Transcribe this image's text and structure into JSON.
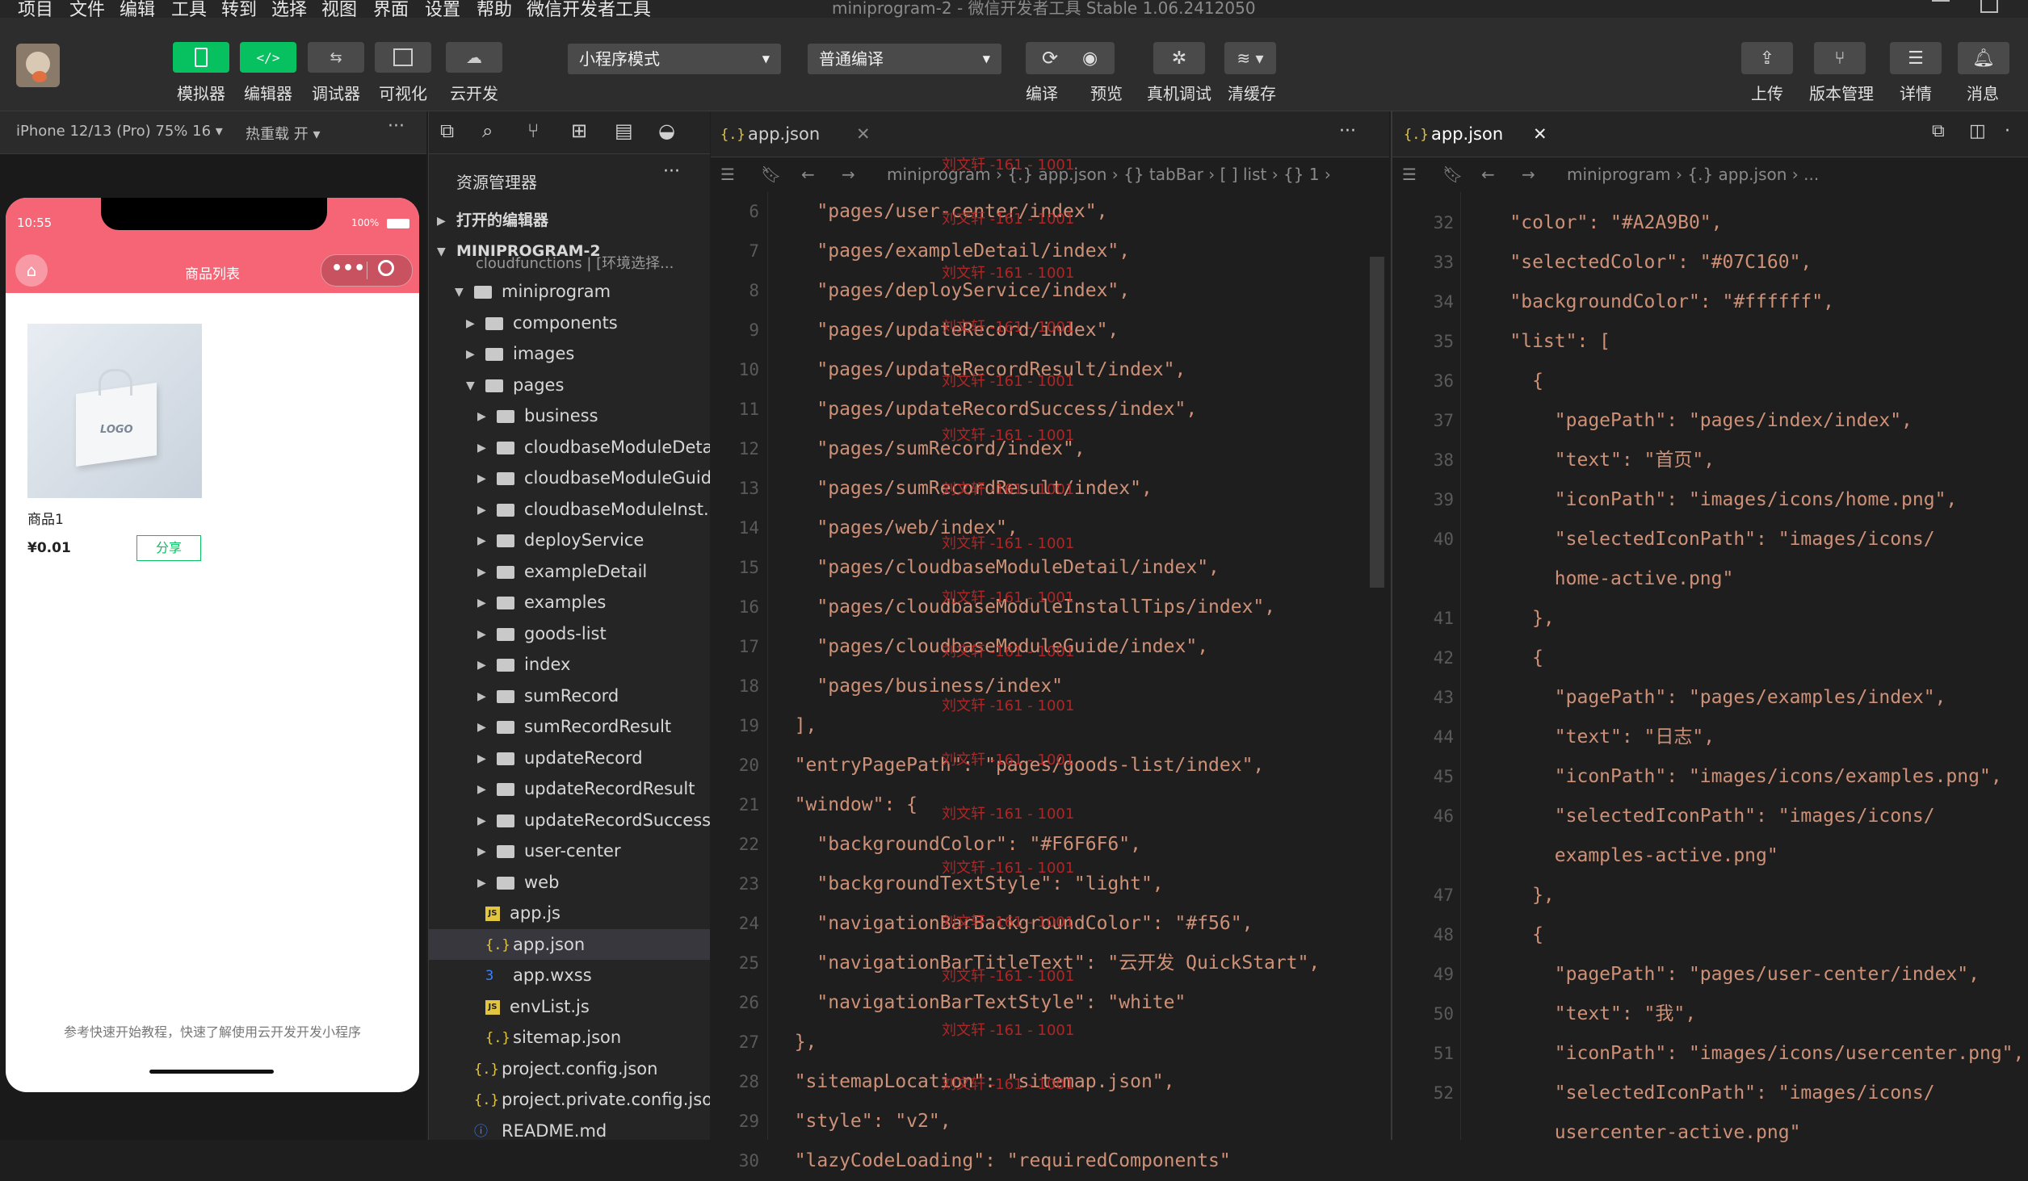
{
  "menu": [
    "项目",
    "文件",
    "编辑",
    "工具",
    "转到",
    "选择",
    "视图",
    "界面",
    "设置",
    "帮助",
    "微信开发者工具"
  ],
  "window_title": "miniprogram-2 - 微信开发者工具 Stable 1.06.2412050",
  "toolbar": {
    "simulator": "模拟器",
    "editor": "编辑器",
    "debugger": "调试器",
    "visual": "可视化",
    "cloud": "云开发",
    "mode": "小程序模式",
    "compile_mode": "普通编译",
    "compile": "编译",
    "preview": "预览",
    "real_debug": "真机调试",
    "clear_cache": "清缓存",
    "upload": "上传",
    "version": "版本管理",
    "details": "详情",
    "messages": "消息"
  },
  "simulator": {
    "device": "iPhone 12/13 (Pro) 75% 16 ▾",
    "hot_reload": "热重载 开 ▾",
    "time": "10:55",
    "battery": "100%",
    "nav_title": "商品列表",
    "product_name": "商品1",
    "product_price": "¥0.01",
    "share": "分享",
    "image_logo": "LOGO",
    "footer_text": "参考快速开始教程，快速了解使用云开发开发小程序"
  },
  "explorer": {
    "title": "资源管理器",
    "open_editors": "打开的编辑器",
    "project": "MINIPROGRAM-2",
    "partial_row": "cloudfunctions | [环境选择...",
    "items": [
      {
        "label": "miniprogram",
        "depth": 1,
        "kind": "folder",
        "open": true
      },
      {
        "label": "components",
        "depth": 2,
        "kind": "folder"
      },
      {
        "label": "images",
        "depth": 2,
        "kind": "folder"
      },
      {
        "label": "pages",
        "depth": 2,
        "kind": "folder",
        "open": true
      },
      {
        "label": "business",
        "depth": 3,
        "kind": "folder"
      },
      {
        "label": "cloudbaseModuleDetail",
        "depth": 3,
        "kind": "folder"
      },
      {
        "label": "cloudbaseModuleGuide",
        "depth": 3,
        "kind": "folder"
      },
      {
        "label": "cloudbaseModuleInst...",
        "depth": 3,
        "kind": "folder"
      },
      {
        "label": "deployService",
        "depth": 3,
        "kind": "folder"
      },
      {
        "label": "exampleDetail",
        "depth": 3,
        "kind": "folder"
      },
      {
        "label": "examples",
        "depth": 3,
        "kind": "folder"
      },
      {
        "label": "goods-list",
        "depth": 3,
        "kind": "folder"
      },
      {
        "label": "index",
        "depth": 3,
        "kind": "folder"
      },
      {
        "label": "sumRecord",
        "depth": 3,
        "kind": "folder"
      },
      {
        "label": "sumRecordResult",
        "depth": 3,
        "kind": "folder"
      },
      {
        "label": "updateRecord",
        "depth": 3,
        "kind": "folder"
      },
      {
        "label": "updateRecordResult",
        "depth": 3,
        "kind": "folder"
      },
      {
        "label": "updateRecordSuccess",
        "depth": 3,
        "kind": "folder"
      },
      {
        "label": "user-center",
        "depth": 3,
        "kind": "folder"
      },
      {
        "label": "web",
        "depth": 3,
        "kind": "folder"
      },
      {
        "label": "app.js",
        "depth": 2,
        "kind": "js"
      },
      {
        "label": "app.json",
        "depth": 2,
        "kind": "json",
        "selected": true
      },
      {
        "label": "app.wxss",
        "depth": 2,
        "kind": "css"
      },
      {
        "label": "envList.js",
        "depth": 2,
        "kind": "js"
      },
      {
        "label": "sitemap.json",
        "depth": 2,
        "kind": "json"
      },
      {
        "label": "project.config.json",
        "depth": 1,
        "kind": "json"
      },
      {
        "label": "project.private.config.json",
        "depth": 1,
        "kind": "json"
      },
      {
        "label": "README.md",
        "depth": 1,
        "kind": "info"
      }
    ]
  },
  "editor1": {
    "tab": "app.json",
    "breadcrumb": "miniprogram  ›  {.} app.json  ›  {} tabBar  ›  [ ] list  ›  {} 1  ›",
    "lines": [
      {
        "n": "6",
        "t": "    \"pages/user-center/index\","
      },
      {
        "n": "7",
        "t": "    \"pages/exampleDetail/index\","
      },
      {
        "n": "8",
        "t": "    \"pages/deployService/index\","
      },
      {
        "n": "9",
        "t": "    \"pages/updateRecord/index\","
      },
      {
        "n": "10",
        "t": "    \"pages/updateRecordResult/index\","
      },
      {
        "n": "11",
        "t": "    \"pages/updateRecordSuccess/index\","
      },
      {
        "n": "12",
        "t": "    \"pages/sumRecord/index\","
      },
      {
        "n": "13",
        "t": "    \"pages/sumRecordResult/index\","
      },
      {
        "n": "14",
        "t": "    \"pages/web/index\","
      },
      {
        "n": "15",
        "t": "    \"pages/cloudbaseModuleDetail/index\","
      },
      {
        "n": "16",
        "t": "    \"pages/cloudbaseModuleInstallTips/index\","
      },
      {
        "n": "17",
        "t": "    \"pages/cloudbaseModuleGuide/index\","
      },
      {
        "n": "18",
        "t": "    \"pages/business/index\""
      },
      {
        "n": "19",
        "t": "  ],"
      },
      {
        "n": "20",
        "t": "  \"entryPagePath\": \"pages/goods-list/index\","
      },
      {
        "n": "21",
        "t": "  \"window\": {"
      },
      {
        "n": "22",
        "t": "    \"backgroundColor\": \"#F6F6F6\","
      },
      {
        "n": "23",
        "t": "    \"backgroundTextStyle\": \"light\","
      },
      {
        "n": "24",
        "t": "    \"navigationBarBackgroundColor\": \"#f56\","
      },
      {
        "n": "25",
        "t": "    \"navigationBarTitleText\": \"云开发 QuickStart\","
      },
      {
        "n": "26",
        "t": "    \"navigationBarTextStyle\": \"white\""
      },
      {
        "n": "27",
        "t": "  },"
      },
      {
        "n": "28",
        "t": "  \"sitemapLocation\": \"sitemap.json\","
      },
      {
        "n": "29",
        "t": "  \"style\": \"v2\","
      },
      {
        "n": "30",
        "t": "  \"lazyCodeLoading\": \"requiredComponents\""
      }
    ]
  },
  "editor2": {
    "tab": "app.json",
    "breadcrumb": "miniprogram  ›  {.} app.json  ›  ...",
    "lines": [
      {
        "n": "32",
        "t": "    \"color\": \"#A2A9B0\","
      },
      {
        "n": "33",
        "t": "    \"selectedColor\": \"#07C160\","
      },
      {
        "n": "34",
        "t": "    \"backgroundColor\": \"#ffffff\","
      },
      {
        "n": "35",
        "t": "    \"list\": ["
      },
      {
        "n": "36",
        "t": "      {"
      },
      {
        "n": "37",
        "t": "        \"pagePath\": \"pages/index/index\","
      },
      {
        "n": "38",
        "t": "        \"text\": \"首页\","
      },
      {
        "n": "39",
        "t": "        \"iconPath\": \"images/icons/home.png\","
      },
      {
        "n": "40",
        "t": "        \"selectedIconPath\": \"images/icons/"
      },
      {
        "n": "",
        "t": "        home-active.png\""
      },
      {
        "n": "41",
        "t": "      },"
      },
      {
        "n": "42",
        "t": "      {"
      },
      {
        "n": "43",
        "t": "        \"pagePath\": \"pages/examples/index\","
      },
      {
        "n": "44",
        "t": "        \"text\": \"日志\","
      },
      {
        "n": "45",
        "t": "        \"iconPath\": \"images/icons/examples.png\","
      },
      {
        "n": "46",
        "t": "        \"selectedIconPath\": \"images/icons/"
      },
      {
        "n": "",
        "t": "        examples-active.png\""
      },
      {
        "n": "47",
        "t": "      },"
      },
      {
        "n": "48",
        "t": "      {"
      },
      {
        "n": "49",
        "t": "        \"pagePath\": \"pages/user-center/index\","
      },
      {
        "n": "50",
        "t": "        \"text\": \"我\","
      },
      {
        "n": "51",
        "t": "        \"iconPath\": \"images/icons/usercenter.png\","
      },
      {
        "n": "52",
        "t": "        \"selectedIconPath\": \"images/icons/"
      },
      {
        "n": "",
        "t": "        usercenter-active.png\""
      }
    ]
  },
  "watermark": "刘文轩 -161 - 1001",
  "colors": {
    "accent": "#07c160",
    "nav_bar": "#f56575",
    "string": "#ce9178"
  }
}
